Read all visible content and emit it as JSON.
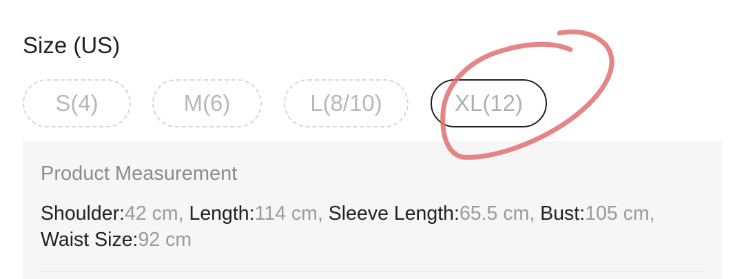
{
  "size": {
    "title": "Size (US)",
    "options": [
      {
        "label": "S(4)",
        "selected": false
      },
      {
        "label": "M(6)",
        "selected": false
      },
      {
        "label": "L(8/10)",
        "selected": false
      },
      {
        "label": "XL(12)",
        "selected": true
      }
    ]
  },
  "measurement": {
    "title": "Product Measurement",
    "items": [
      {
        "key": "Shoulder:",
        "value": "42 cm",
        "sep": ", "
      },
      {
        "key": "Length:",
        "value": "114 cm",
        "sep": ", "
      },
      {
        "key": "Sleeve Length:",
        "value": "65.5 cm",
        "sep": ", "
      },
      {
        "key": "Bust:",
        "value": "105 cm",
        "sep": ", "
      },
      {
        "key": "Waist Size:",
        "value": "92 cm",
        "sep": ""
      }
    ]
  },
  "colors": {
    "annotation_red": "#e07070",
    "selected_border": "#1f1f1f"
  }
}
